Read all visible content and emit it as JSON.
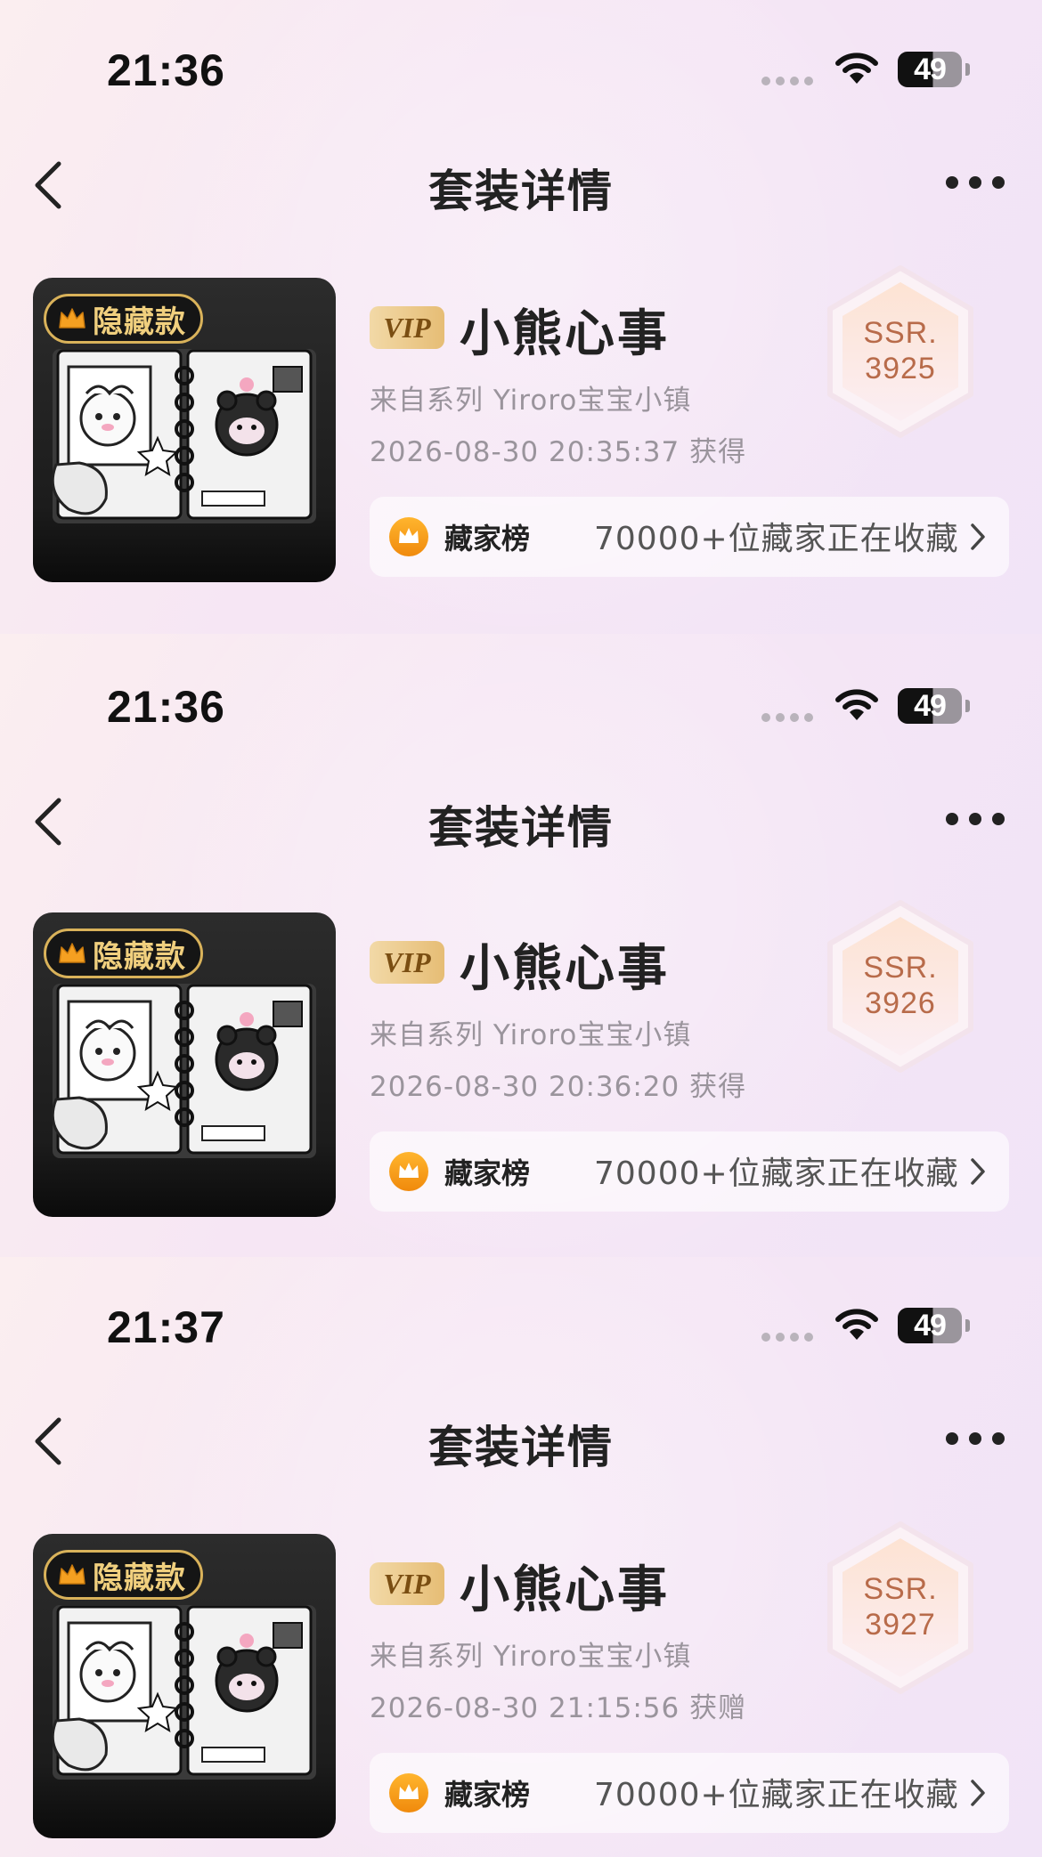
{
  "panels": [
    {
      "status_time": "21:36",
      "battery_level": "49",
      "nav_title": "套装详情",
      "hidden_badge": "隐藏款",
      "vip_label": "VIP",
      "item_name": "小熊心事",
      "series": "来自系列 Yiroro宝宝小镇",
      "obtained": "2026-08-30 20:35:37 获得",
      "ssr_grade": "SSR.",
      "ssr_number": "3925",
      "rank_title": "藏家榜",
      "rank_desc": "70000+位藏家正在收藏"
    },
    {
      "status_time": "21:36",
      "battery_level": "49",
      "nav_title": "套装详情",
      "hidden_badge": "隐藏款",
      "vip_label": "VIP",
      "item_name": "小熊心事",
      "series": "来自系列 Yiroro宝宝小镇",
      "obtained": "2026-08-30 20:36:20 获得",
      "ssr_grade": "SSR.",
      "ssr_number": "3926",
      "rank_title": "藏家榜",
      "rank_desc": "70000+位藏家正在收藏"
    },
    {
      "status_time": "21:37",
      "battery_level": "49",
      "nav_title": "套装详情",
      "hidden_badge": "隐藏款",
      "vip_label": "VIP",
      "item_name": "小熊心事",
      "series": "来自系列 Yiroro宝宝小镇",
      "obtained": "2026-08-30 21:15:56 获赠",
      "ssr_grade": "SSR.",
      "ssr_number": "3927",
      "rank_title": "藏家榜",
      "rank_desc": "70000+位藏家正在收藏"
    }
  ],
  "icons": {
    "back": "back-chevron-icon",
    "more": "more-dots-icon",
    "wifi": "wifi-icon",
    "battery": "battery-icon",
    "crown": "crown-icon",
    "chevron": "chevron-right-icon"
  },
  "colors": {
    "vip_gold": "#e6bd75",
    "ssr_text": "#b86b4a",
    "crown_orange": "#f5a021",
    "badge_gold": "#f0cf7e"
  }
}
